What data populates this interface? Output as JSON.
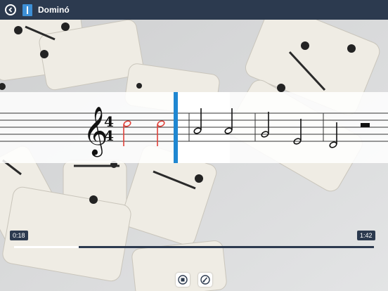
{
  "header": {
    "title": "Dominó",
    "back_icon": "back-arrow-icon",
    "app_icon": "score-icon"
  },
  "playback": {
    "elapsed": "0:18",
    "total": "1:42",
    "progress": 0.18
  },
  "score": {
    "clef": "treble",
    "time_signature": {
      "top": "4",
      "bottom": "4"
    },
    "played_color": "#e0423a",
    "cursor_color": "#1f87d1",
    "notes_visible": 7
  },
  "controls": {
    "stop_icon": "stop-icon",
    "brush_icon": "brush-icon"
  }
}
